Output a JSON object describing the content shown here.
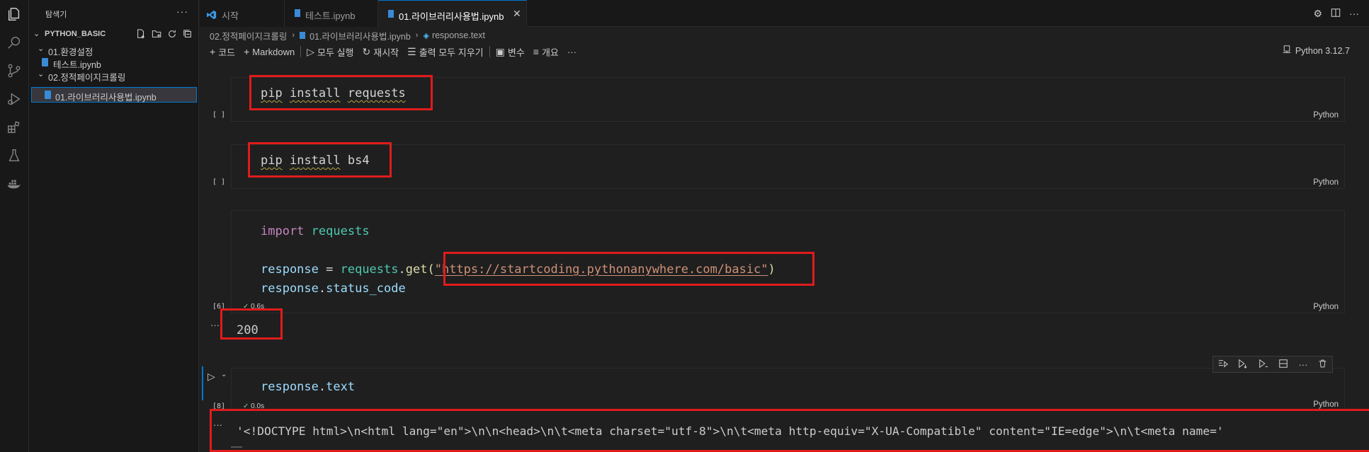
{
  "sidebar": {
    "title": "탐색기",
    "root": "PYTHON_BASIC",
    "items": [
      {
        "label": "01.환경설정"
      },
      {
        "label": "테스트.ipynb"
      },
      {
        "label": "02.정적페이지크롤링"
      },
      {
        "label": "01.라이브러리사용법.ipynb"
      }
    ]
  },
  "tabs": [
    {
      "label": "시작"
    },
    {
      "label": "테스트.ipynb"
    },
    {
      "label": "01.라이브러리사용법.ipynb"
    }
  ],
  "breadcrumb": [
    "02.정적페이지크롤링",
    "01.라이브러리사용법.ipynb",
    "response.text"
  ],
  "toolbar": {
    "code": "코드",
    "markdown": "Markdown",
    "run_all": "모두 실행",
    "restart": "재시작",
    "clear_outputs": "출력 모두 지우기",
    "variables": "변수",
    "outline": "개요",
    "more": "···",
    "kernel": "Python 3.12.7"
  },
  "cells": [
    {
      "exec": "[ ]",
      "lang": "Python"
    },
    {
      "exec": "[ ]",
      "lang": "Python"
    },
    {
      "exec": "[6]",
      "lang": "Python",
      "time": "0.6s",
      "output": "200"
    },
    {
      "exec": "[8]",
      "lang": "Python",
      "time": "0.0s"
    }
  ],
  "code": {
    "cell1": {
      "pip": "pip",
      "install": "install",
      "pkg": "requests"
    },
    "cell2": {
      "pip": "pip",
      "install": "install",
      "pkg": "bs4"
    },
    "cell3": {
      "import_kw": "import",
      "import_mod": "requests",
      "response_var": "response",
      "eq": " = ",
      "requests_obj": "requests",
      "dot": ".",
      "get_fn": "get",
      "paren_open": "(",
      "url": "\"https://startcoding.pythonanywhere.com/basic\"",
      "paren_close": ")",
      "status_obj": "response",
      "status_attr": "status_code"
    },
    "cell4": {
      "obj": "response",
      "attr": "text"
    }
  },
  "output_text": "'<!DOCTYPE html>\\n<html lang=\"en\">\\n\\n<head>\\n\\t<meta charset=\"utf-8\">\\n\\t<meta http-equiv=\"X-UA-Compatible\" content=\"IE=edge\">\\n\\t<meta name='",
  "output_ellipsis": "···",
  "colors": {
    "accent": "#0078d4",
    "highlight_box": "#e01b1b"
  }
}
